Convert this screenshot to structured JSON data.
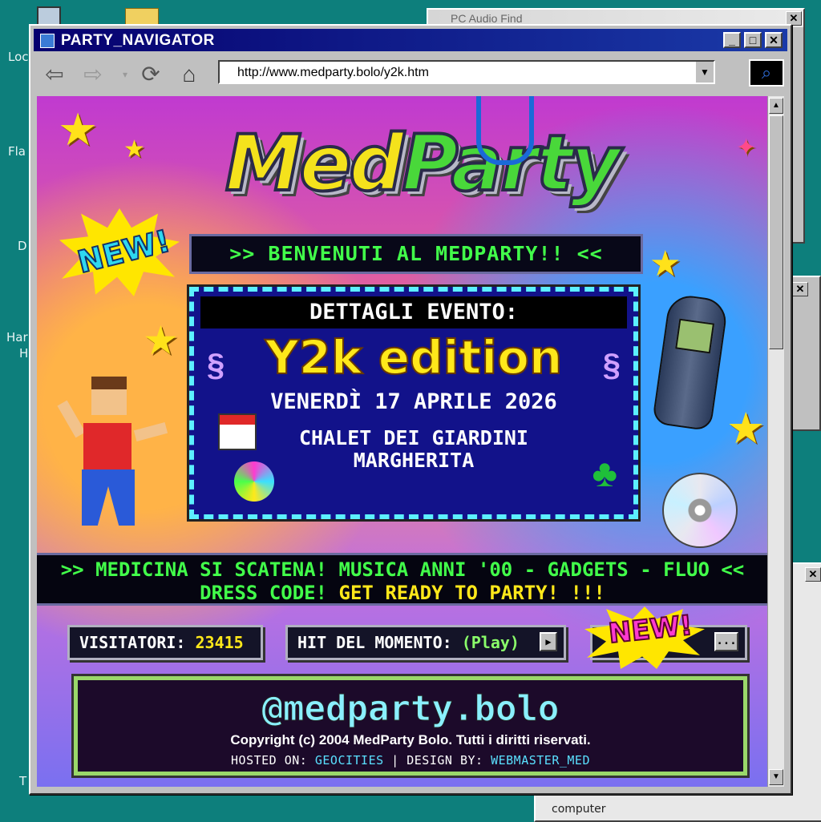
{
  "desktop": {
    "icon_labels": [
      "Loc",
      "Fla",
      "D",
      "Har",
      "H",
      "T"
    ],
    "bottom_labels": [
      "computer"
    ],
    "background_window_title": "PC Audio Find"
  },
  "window": {
    "title": "PARTY_NAVIGATOR",
    "min": "_",
    "max": "□",
    "close": "✕"
  },
  "toolbar": {
    "back": "⇦",
    "forward": "⇨",
    "refresh": "⟳",
    "home": "⌂",
    "address": "http://www.medparty.bolo/y2k.htm",
    "go": "⌕"
  },
  "page": {
    "logo_part1": "Med",
    "logo_part2": "Party",
    "new_badge": "NEW!",
    "welcome": ">> BENVENUTI AL MEDPARTY!! <<",
    "event": {
      "heading": "DETTAGLI EVENTO:",
      "edition": "Y2k edition",
      "date": "VENERDÌ 17 APRILE 2026",
      "venue_line1": "CHALET DEI GIARDINI",
      "venue_line2": "MARGHERITA"
    },
    "ticker": {
      "line1": ">> MEDICINA SI SCATENA! MUSICA ANNI '00 - GADGETS - FLUO <<",
      "line2_a": "DRESS CODE!",
      "line2_b": "GET READY TO PARTY! !!!"
    },
    "panels": {
      "visitors_label": "VISITATORI:",
      "visitors_value": "23415",
      "hit_label": "HIT DEL MOMENTO:",
      "hit_value": "(Play)",
      "new_label": "NEW!",
      "more": "..."
    },
    "footer": {
      "handle": "@medparty.bolo",
      "copyright": "Copyright (c) 2004 MedParty Bolo. Tutti i diritti riservati.",
      "hosted_label": "HOSTED ON:",
      "hosted_value": "GEOCITIES",
      "sep": "|",
      "design_label": "DESIGN BY:",
      "design_value": "WEBMASTER_MED"
    }
  },
  "colors": {
    "title_bar": "#06006e",
    "welcome_text": "#42ff4a",
    "edition_text": "#ffe81a",
    "event_bg": "#12128a"
  }
}
